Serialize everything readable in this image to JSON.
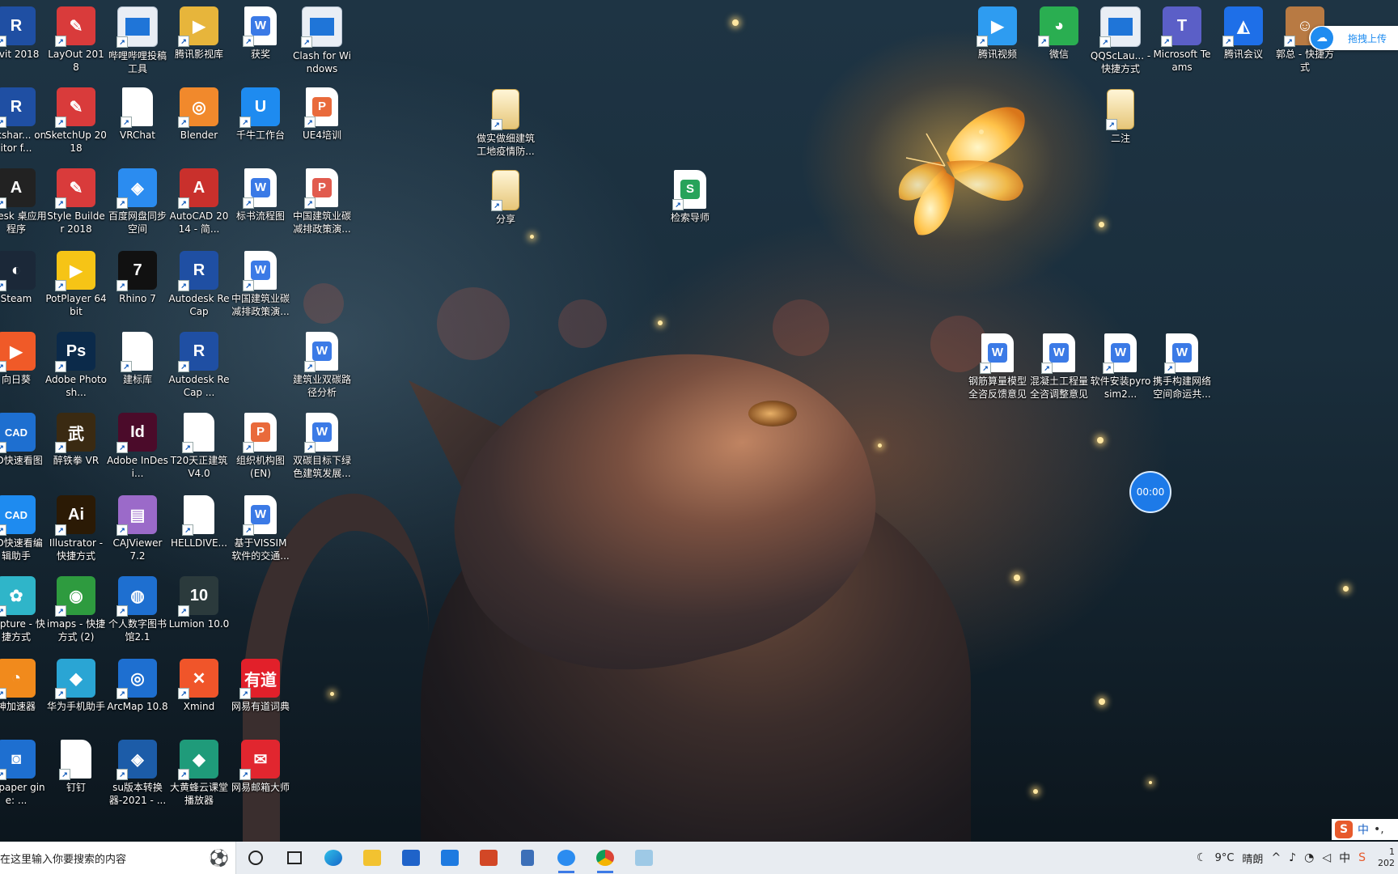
{
  "desktop": {
    "icons": [
      {
        "label": "evit 2018",
        "glyph": "R",
        "color": "#1f4fa3"
      },
      {
        "label": "LayOut 2018",
        "glyph": "✎",
        "color": "#d93b3b"
      },
      {
        "label": "哔哩哔哩投稿工具",
        "glyph": "",
        "color": "#1f75d8"
      },
      {
        "label": "腾讯影视库",
        "glyph": "▶",
        "color": "#e7b53b"
      },
      {
        "label": "获奖",
        "glyph": "W",
        "color": "#3b7ae6"
      },
      {
        "label": "Clash for Windows",
        "glyph": "",
        "color": "#1f75d8"
      },
      {
        "label": "orkshar... onitor f...",
        "glyph": "R",
        "color": "#1f4fa3"
      },
      {
        "label": "SketchUp 2018",
        "glyph": "✎",
        "color": "#d93b3b"
      },
      {
        "label": "VRChat",
        "glyph": "",
        "color": "#ffffff"
      },
      {
        "label": "Blender",
        "glyph": "◎",
        "color": "#f1892c"
      },
      {
        "label": "千牛工作台",
        "glyph": "U",
        "color": "#1e8bf0"
      },
      {
        "label": "UE4培训",
        "glyph": "P",
        "color": "#e96a3b"
      },
      {
        "label": "odesk 桌应用程序",
        "glyph": "A",
        "color": "#222222"
      },
      {
        "label": "Style Builder 2018",
        "glyph": "✎",
        "color": "#d93b3b"
      },
      {
        "label": "百度网盘同步空间",
        "glyph": "◈",
        "color": "#2b8cf0"
      },
      {
        "label": "AutoCAD 2014 - 简...",
        "glyph": "A",
        "color": "#c9302c"
      },
      {
        "label": "标书流程图",
        "glyph": "W",
        "color": "#3b7ae6"
      },
      {
        "label": "中国建筑业碳减排政策演...",
        "glyph": "P",
        "color": "#e15b4e"
      },
      {
        "label": "Steam",
        "glyph": "◐",
        "color": "#1b2838"
      },
      {
        "label": "PotPlayer 64 bit",
        "glyph": "▶",
        "color": "#f6c416"
      },
      {
        "label": "Rhino 7",
        "glyph": "7",
        "color": "#111111"
      },
      {
        "label": "Autodesk ReCap",
        "glyph": "R",
        "color": "#1f4fa3"
      },
      {
        "label": "中国建筑业碳减排政策演...",
        "glyph": "W",
        "color": "#3b7ae6"
      },
      {
        "label": "向日葵",
        "glyph": "▶",
        "color": "#f05a28"
      },
      {
        "label": "Adobe Photosh...",
        "glyph": "Ps",
        "color": "#0b2a4a"
      },
      {
        "label": "建标库",
        "glyph": "",
        "color": "#ffffff"
      },
      {
        "label": "Autodesk ReCap ...",
        "glyph": "R",
        "color": "#1f4fa3"
      },
      {
        "label": "建筑业双碳路径分析",
        "glyph": "W",
        "color": "#3b7ae6"
      },
      {
        "label": "AD快速看图",
        "glyph": "CAD",
        "color": "#1e6fd0"
      },
      {
        "label": "醉铁拳 VR",
        "glyph": "武",
        "color": "#3a2a12"
      },
      {
        "label": "Adobe InDesi...",
        "glyph": "Id",
        "color": "#4b0b2a"
      },
      {
        "label": "T20天正建筑 V4.0",
        "glyph": "T",
        "color": "#ffffff"
      },
      {
        "label": "组织机构图 (EN)",
        "glyph": "P",
        "color": "#e96a3b"
      },
      {
        "label": "双碳目标下绿色建筑发展...",
        "glyph": "W",
        "color": "#3b7ae6"
      },
      {
        "label": "AD快速看编辑助手",
        "glyph": "CAD",
        "color": "#1e8bf0"
      },
      {
        "label": "Illustrator - 快捷方式",
        "glyph": "Ai",
        "color": "#2b1a05"
      },
      {
        "label": "CAJViewer 7.2",
        "glyph": "▤",
        "color": "#9b6ac9"
      },
      {
        "label": "HELLDIVE...",
        "glyph": "",
        "color": "#ffffff"
      },
      {
        "label": "基于VISSIM软件的交通...",
        "glyph": "W",
        "color": "#3b7ae6"
      },
      {
        "label": "Capture - 快捷方式",
        "glyph": "✿",
        "color": "#2fb5c9"
      },
      {
        "label": "imaps - 快捷方式 (2)",
        "glyph": "◉",
        "color": "#2e9b3f"
      },
      {
        "label": "个人数字图书馆2.1",
        "glyph": "◍",
        "color": "#1e6fd0"
      },
      {
        "label": "Lumion 10.0",
        "glyph": "10",
        "color": "#2b3a3c"
      },
      {
        "label": "神加速器",
        "glyph": "◔",
        "color": "#f18a1c"
      },
      {
        "label": "华为手机助手",
        "glyph": "◆",
        "color": "#2aa5d4"
      },
      {
        "label": "ArcMap 10.8",
        "glyph": "◎",
        "color": "#1e6fd0"
      },
      {
        "label": "Xmind",
        "glyph": "✕",
        "color": "#f0552a"
      },
      {
        "label": "网易有道词典",
        "glyph": "有道",
        "color": "#e2202a"
      },
      {
        "label": "allpaper gine: ...",
        "glyph": "◙",
        "color": "#1e6fd0"
      },
      {
        "label": "钉钉",
        "glyph": "",
        "color": "#ffffff"
      },
      {
        "label": "su版本转换器-2021 - ...",
        "glyph": "◈",
        "color": "#1c5ca8"
      },
      {
        "label": "大黄蜂云课堂播放器",
        "glyph": "◆",
        "color": "#1f9b7a"
      },
      {
        "label": "网易邮箱大师",
        "glyph": "✉",
        "color": "#e1262f"
      },
      {
        "label": "做实做细建筑工地疫情防...",
        "glyph": "",
        "color": "#e7c678"
      },
      {
        "label": "分享",
        "glyph": "",
        "color": "#e7c678"
      },
      {
        "label": "检索导师",
        "glyph": "S",
        "color": "#27a35a"
      },
      {
        "label": "腾讯视频",
        "glyph": "▶",
        "color": "#2e9cf1"
      },
      {
        "label": "微信",
        "glyph": "◕",
        "color": "#2aae51"
      },
      {
        "label": "QQScLau... - 快捷方式",
        "glyph": "",
        "color": "#1f75d8"
      },
      {
        "label": "Microsoft Teams",
        "glyph": "T",
        "color": "#5b5fc7"
      },
      {
        "label": "腾讯会议",
        "glyph": "◭",
        "color": "#1e6fe8"
      },
      {
        "label": "郭总 - 快捷方式",
        "glyph": "☺",
        "color": "#b87a43"
      },
      {
        "label": "二注",
        "glyph": "",
        "color": "#e7c678"
      },
      {
        "label": "钢筋算量模型全咨反馈意见",
        "glyph": "W",
        "color": "#3b7ae6"
      },
      {
        "label": "混凝土工程量全咨调整意见",
        "glyph": "W",
        "color": "#3b7ae6"
      },
      {
        "label": "软件安装pyrosim2...",
        "glyph": "W",
        "color": "#3b7ae6"
      },
      {
        "label": "携手构建网络空间命运共...",
        "glyph": "W",
        "color": "#3b7ae6"
      }
    ]
  },
  "recorder": {
    "time": "00:00"
  },
  "upload": {
    "label": "拖拽上传"
  },
  "ime": {
    "logo": "S",
    "lang": "中",
    "punct": "•,"
  },
  "taskbar": {
    "search_placeholder": "在这里输入你要搜索的内容",
    "weather_temp": "9°C",
    "weather_text": "晴朗",
    "clock_top": "1",
    "clock_bottom": "202"
  }
}
